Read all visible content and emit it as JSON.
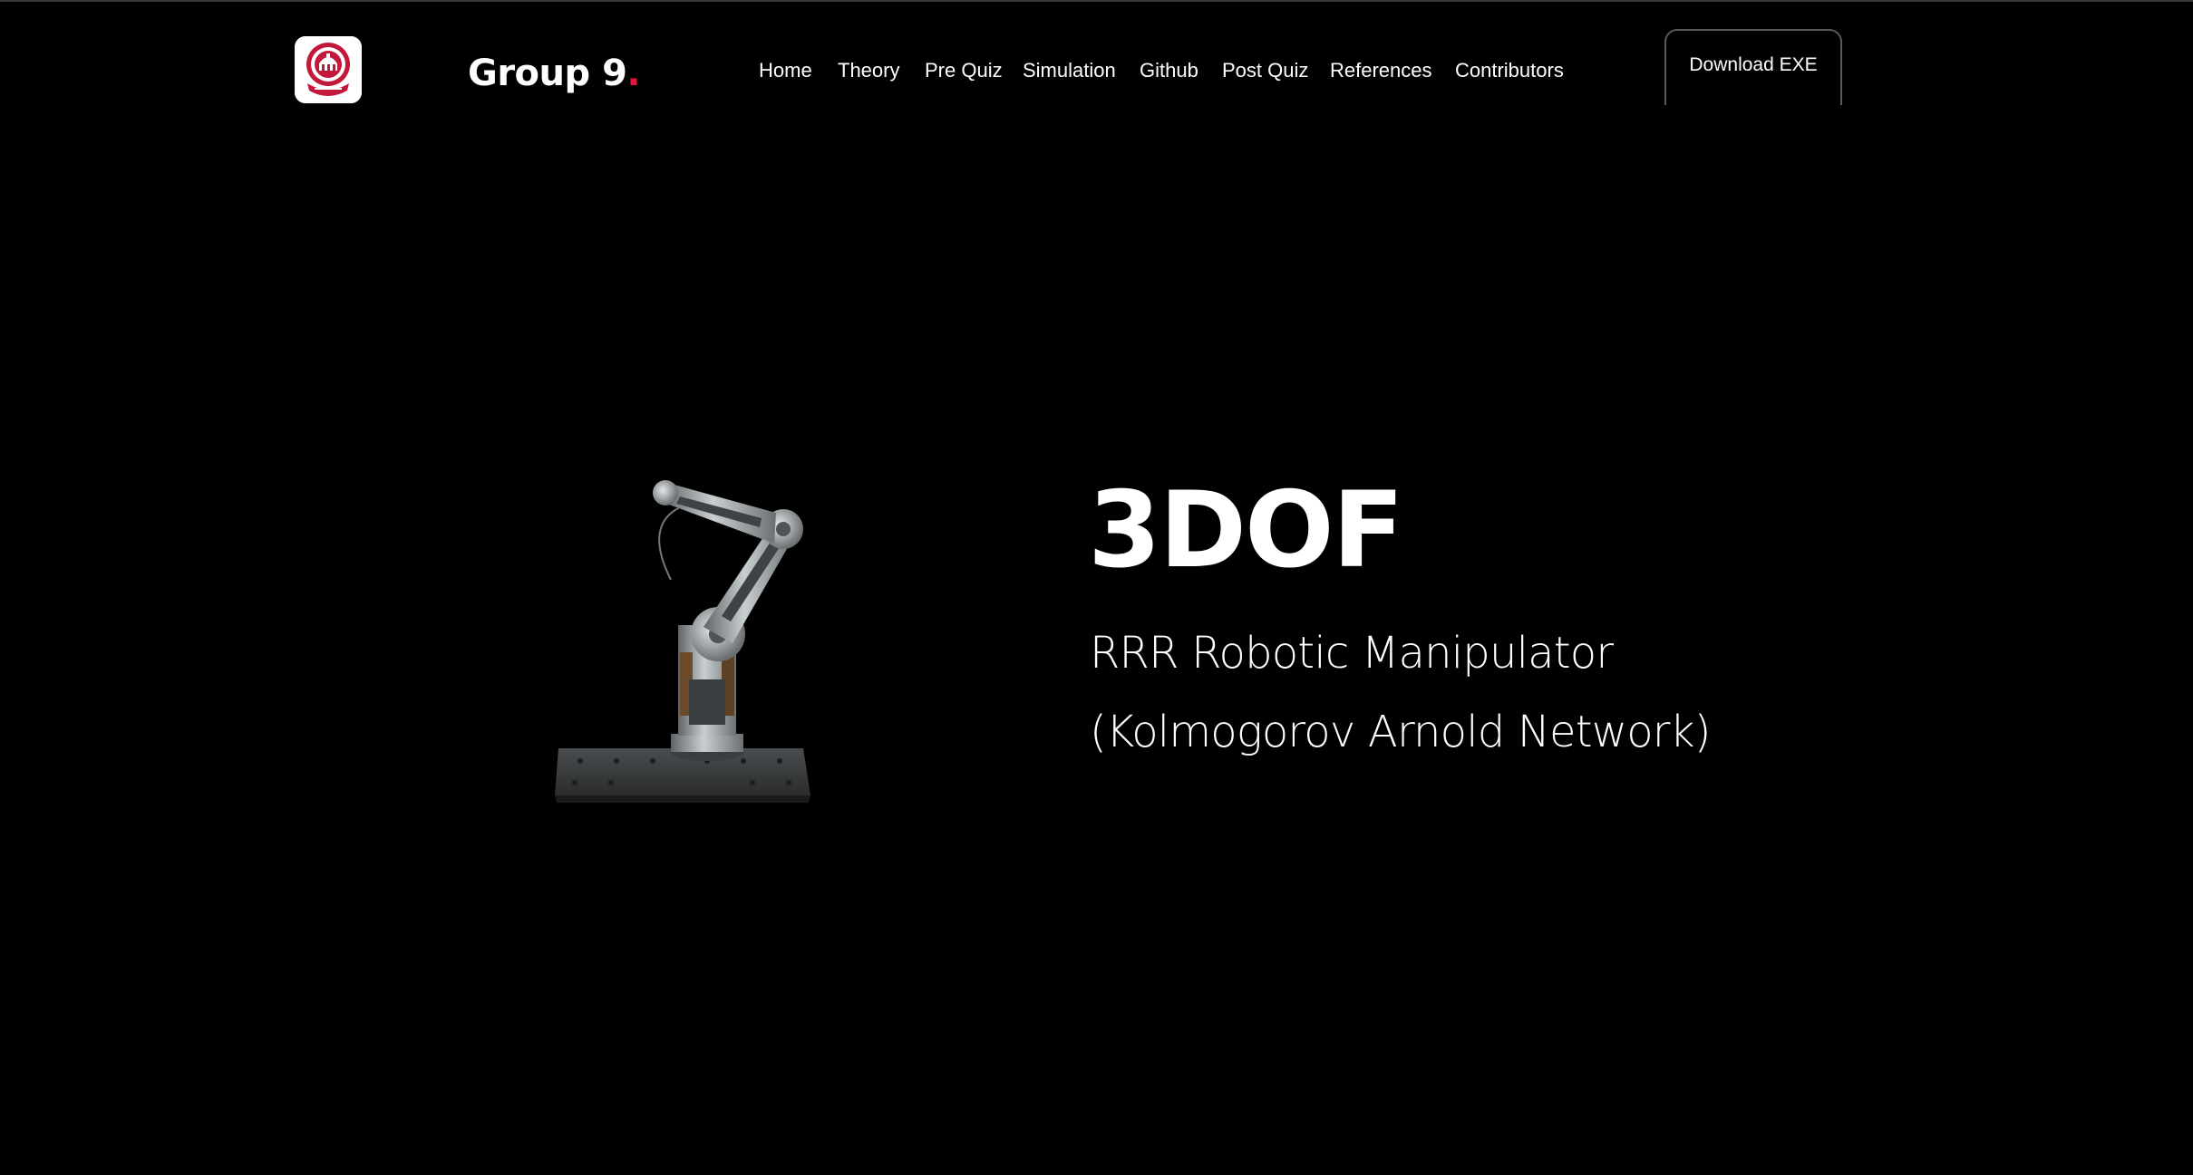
{
  "header": {
    "brand": {
      "name": "Group 9",
      "dot": ".",
      "dot_color": "#e0173a"
    },
    "logo_icon": "college-emblem-icon",
    "nav": [
      "Home",
      "Theory",
      "Pre Quiz",
      "Simulation",
      "Github",
      "Post Quiz",
      "References",
      "Contributors"
    ],
    "download_label": "Download EXE"
  },
  "hero": {
    "title": "3DOF",
    "subtitle_line1": "RRR Robotic Manipulator",
    "subtitle_line2": "(Kolmogorov Arnold Network)",
    "image_icon": "robotic-arm-image"
  },
  "colors": {
    "background": "#000000",
    "text": "#ffffff",
    "accent": "#e0173a"
  }
}
